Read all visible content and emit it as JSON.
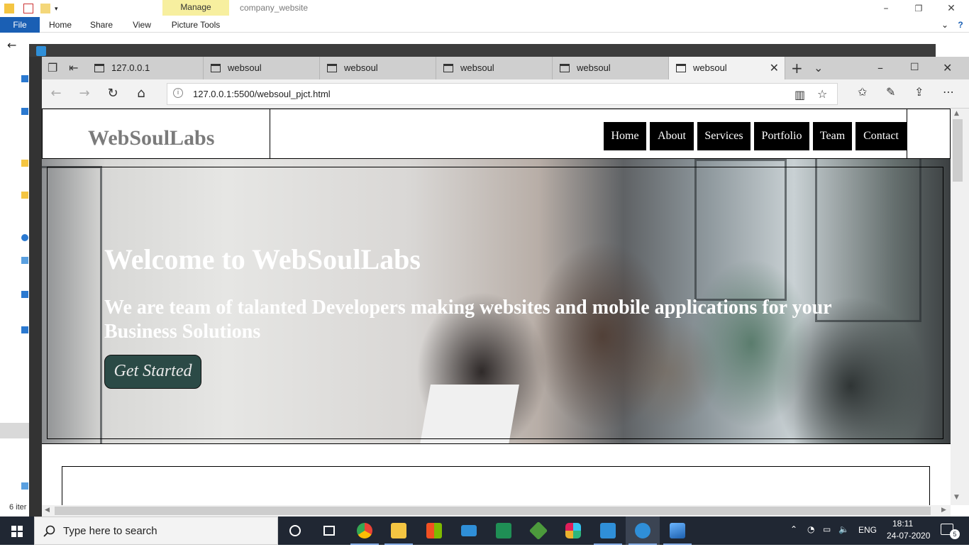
{
  "explorer": {
    "manage_tab": "Manage",
    "folder_name": "company_website",
    "tabs": {
      "file": "File",
      "home": "Home",
      "share": "Share",
      "view": "View",
      "picture_tools": "Picture Tools"
    },
    "items_count": "6 iter"
  },
  "browser": {
    "tabs": [
      {
        "label": "127.0.0.1"
      },
      {
        "label": "websoul"
      },
      {
        "label": "websoul"
      },
      {
        "label": "websoul"
      },
      {
        "label": "websoul"
      },
      {
        "label": "websoul"
      }
    ],
    "url": "127.0.0.1:5500/websoul_pjct.html"
  },
  "site": {
    "brand": "WebSoulLabs",
    "menu": [
      "Home",
      "About",
      "Services",
      "Portfolio",
      "Team",
      "Contact"
    ],
    "hero": {
      "title": "Welcome to WebSoulLabs",
      "subtitle": "We are team of talanted Developers making websites and mobile applications for your Business Solutions",
      "cta": "Get Started"
    }
  },
  "taskbar": {
    "search_placeholder": "Type here to search",
    "language": "ENG",
    "time": "18:11",
    "date": "24-07-2020",
    "notification_count": "5",
    "apps": [
      "task-view",
      "chrome",
      "file-explorer",
      "store",
      "mail",
      "app-green",
      "node",
      "slack",
      "vscode",
      "edge",
      "photos"
    ],
    "colors": {
      "taskbar": "#202733",
      "accent": "#7ea6e0"
    }
  }
}
